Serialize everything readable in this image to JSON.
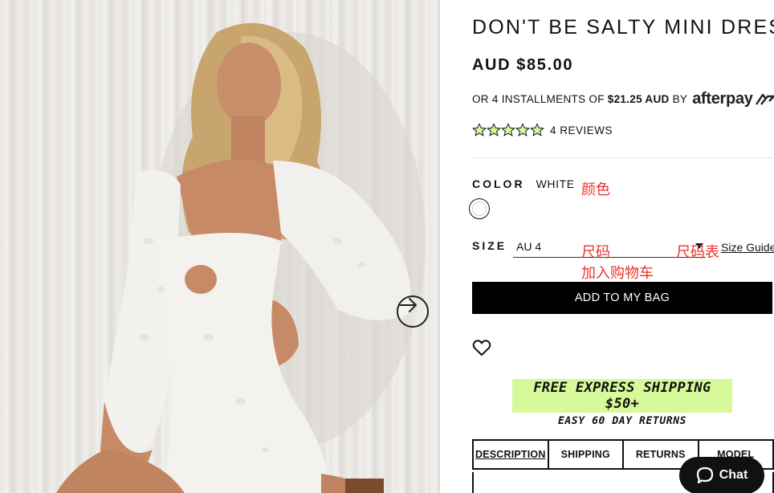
{
  "product": {
    "title": "DON'T BE SALTY MINI DRESS",
    "price": "AUD $85.00",
    "image_alt_icon": "product-photo"
  },
  "afterpay": {
    "prefix": "OR 4 INSTALLMENTS OF",
    "amount": "$21.25 AUD",
    "by": "BY",
    "logo_text": "afterpay"
  },
  "reviews": {
    "rating": 5,
    "max": 5,
    "text": "4 REVIEWS"
  },
  "color": {
    "label": "COLOR",
    "value": "WHITE",
    "swatch_color": "#ffffff"
  },
  "size": {
    "label": "SIZE",
    "selected": "AU 4",
    "guide": "Size Guide"
  },
  "annotations": {
    "color_note": "颜色",
    "size_note": "尺码",
    "size_guide_note": "尺码表",
    "add_to_bag_note": "加入购物车"
  },
  "actions": {
    "add_to_bag": "ADD TO MY BAG",
    "wishlist_icon": "heart-icon"
  },
  "shipping": {
    "main": "FREE EXPRESS SHIPPING $50+",
    "sub": "EASY 60 DAY RETURNS",
    "highlight_color": "#d6f99a"
  },
  "tabs": [
    {
      "label": "DESCRIPTION"
    },
    {
      "label": "SHIPPING"
    },
    {
      "label": "RETURNS"
    },
    {
      "label": "MODEL"
    }
  ],
  "chat": {
    "label": "Chat"
  },
  "colors": {
    "button_bg": "#000000",
    "annotation": "#e8332f"
  }
}
